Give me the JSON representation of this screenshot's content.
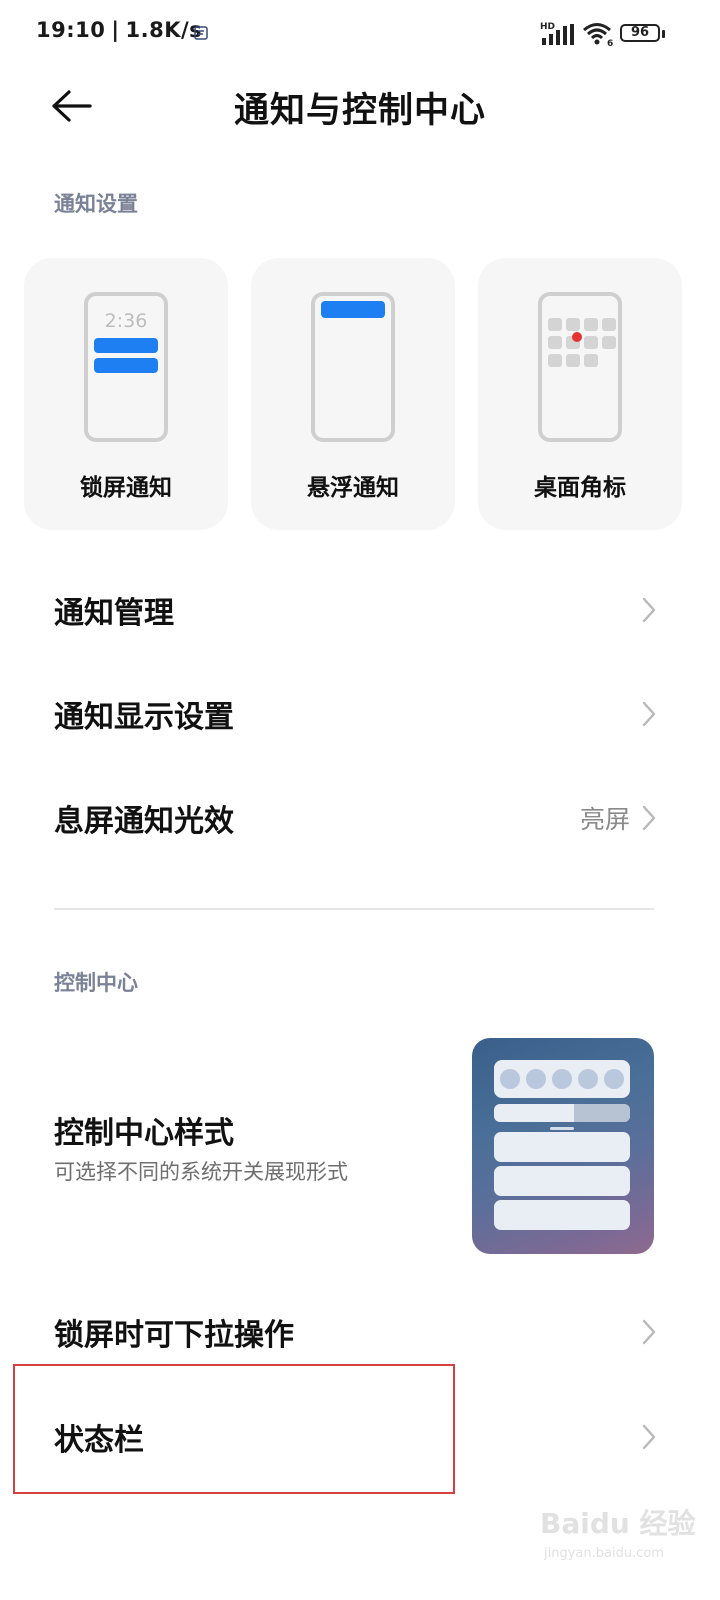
{
  "status_bar": {
    "time": "19:10",
    "separator": "|",
    "net_speed": "1.8K/s",
    "network_label": "HD",
    "wifi_sub": "6",
    "battery": "96"
  },
  "header": {
    "title": "通知与控制中心"
  },
  "notification_section": {
    "label": "通知设置",
    "cards": [
      {
        "label": "锁屏通知",
        "preview_time": "2:36"
      },
      {
        "label": "悬浮通知"
      },
      {
        "label": "桌面角标"
      }
    ]
  },
  "rows": [
    {
      "title": "通知管理"
    },
    {
      "title": "通知显示设置"
    },
    {
      "title": "息屏通知光效",
      "value": "亮屏"
    }
  ],
  "control_section": {
    "label": "控制中心",
    "style_title": "控制中心样式",
    "style_subtitle": "可选择不同的系统开关展现形式",
    "rows": [
      {
        "title": "锁屏时可下拉操作"
      },
      {
        "title": "状态栏"
      }
    ]
  },
  "watermark": {
    "main": "Baidu 经验",
    "sub": "jingyan.baidu.com"
  },
  "colors": {
    "accent_blue": "#1e7ff2",
    "badge_red": "#e63232",
    "highlight_red": "#d64040",
    "section_label": "#7a8297"
  }
}
